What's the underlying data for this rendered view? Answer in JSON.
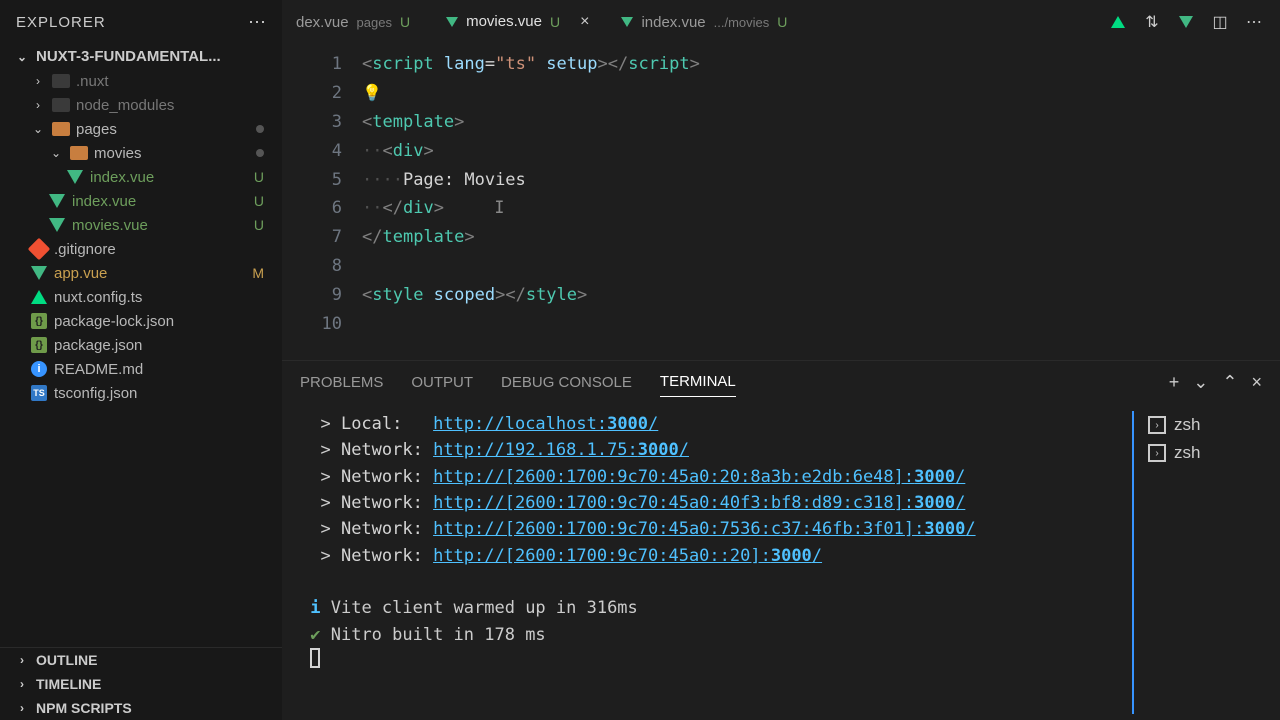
{
  "explorer": {
    "title": "EXPLORER",
    "project": "NUXT-3-FUNDAMENTAL..."
  },
  "tree": {
    "nuxt_folder": ".nuxt",
    "node_modules": "node_modules",
    "pages": "pages",
    "movies_folder": "movies",
    "movies_index": "index.vue",
    "root_index": "index.vue",
    "movies_vue": "movies.vue",
    "gitignore": ".gitignore",
    "app_vue": "app.vue",
    "nuxt_config": "nuxt.config.ts",
    "pkg_lock": "package-lock.json",
    "pkg": "package.json",
    "readme": "README.md",
    "tsconfig": "tsconfig.json"
  },
  "git": {
    "U": "U",
    "M": "M"
  },
  "sections": {
    "outline": "OUTLINE",
    "timeline": "TIMELINE",
    "npm": "NPM SCRIPTS"
  },
  "tabs": {
    "t1_name": "dex.vue",
    "t1_sub": "pages",
    "t2_name": "movies.vue",
    "t3_name": "index.vue",
    "t3_sub": ".../movies"
  },
  "editor": {
    "line_nums": [
      "1",
      "2",
      "3",
      "4",
      "5",
      "6",
      "7",
      "8",
      "9",
      "10"
    ],
    "script_open1": "<",
    "script_tag": "script",
    "lang_attr": " lang",
    "eq": "=",
    "ts_str": "\"ts\"",
    "setup": " setup",
    "close_brk": ">",
    "end_open": "</",
    "template_tag": "template",
    "div_tag": "div",
    "page_text": "Page: Movies",
    "style_tag": "style",
    "scoped": " scoped",
    "dots2": "··",
    "dots4": "····"
  },
  "panel": {
    "problems": "PROBLEMS",
    "output": "OUTPUT",
    "debug": "DEBUG CONSOLE",
    "terminal": "TERMINAL"
  },
  "terminal": {
    "arrow": "  > ",
    "local_lbl": "Local:   ",
    "net_lbl": "Network: ",
    "url1_a": "http://localhost:",
    "port": "3000",
    "slash": "/",
    "url2_a": "http://192.168.1.75:",
    "url3_a": "http://[2600:1700:9c70:45a0:20:8a3b:e2db:6e48]:",
    "url4_a": "http://[2600:1700:9c70:45a0:40f3:bf8:d89:c318]:",
    "url5_a": "http://[2600:1700:9c70:45a0:7536:c37:46fb:3f01]:",
    "url6_a": "http://[2600:1700:9c70:45a0::20]:",
    "info_i": "i",
    "vite_msg": " Vite client warmed up in 316ms",
    "check": "✔",
    "nitro_msg": " Nitro built in 178 ms",
    "shell": "zsh"
  }
}
